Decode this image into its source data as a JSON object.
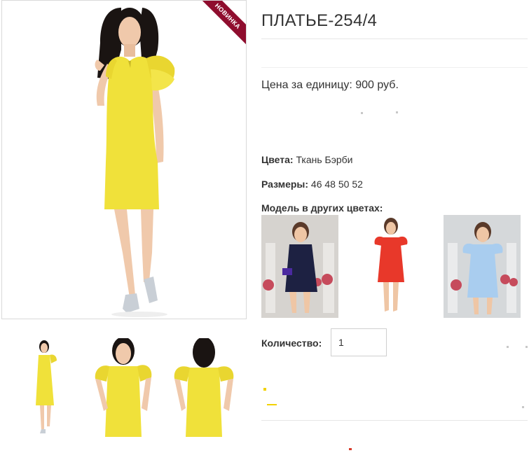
{
  "product": {
    "title": "ПЛАТЬЕ-254/4",
    "badge": "НОВИНКА",
    "price_text": "Цена за единицу: 900 руб.",
    "colors_label": "Цвета:",
    "colors_value": " Ткань Бэрби",
    "sizes_label": "Размеры:",
    "sizes_value": " 46 48 50 52",
    "other_colors_title": "Модель в других цветах:",
    "quantity_label": "Количество:",
    "quantity_value": "1"
  },
  "images": {
    "main_dress_color": "#f0e13a",
    "thumbnails": [
      "front-full",
      "front-closeup",
      "back-closeup"
    ],
    "variants": [
      {
        "dress_color": "#1d2142",
        "background": "indoor-flowers"
      },
      {
        "dress_color": "#e8382a",
        "background": "white"
      },
      {
        "dress_color": "#a9cdef",
        "background": "indoor-flowers"
      }
    ]
  },
  "colors": {
    "badge": "#8f0d2e",
    "dress_yellow": "#f0e13a",
    "divider": "#e7e7e7"
  }
}
